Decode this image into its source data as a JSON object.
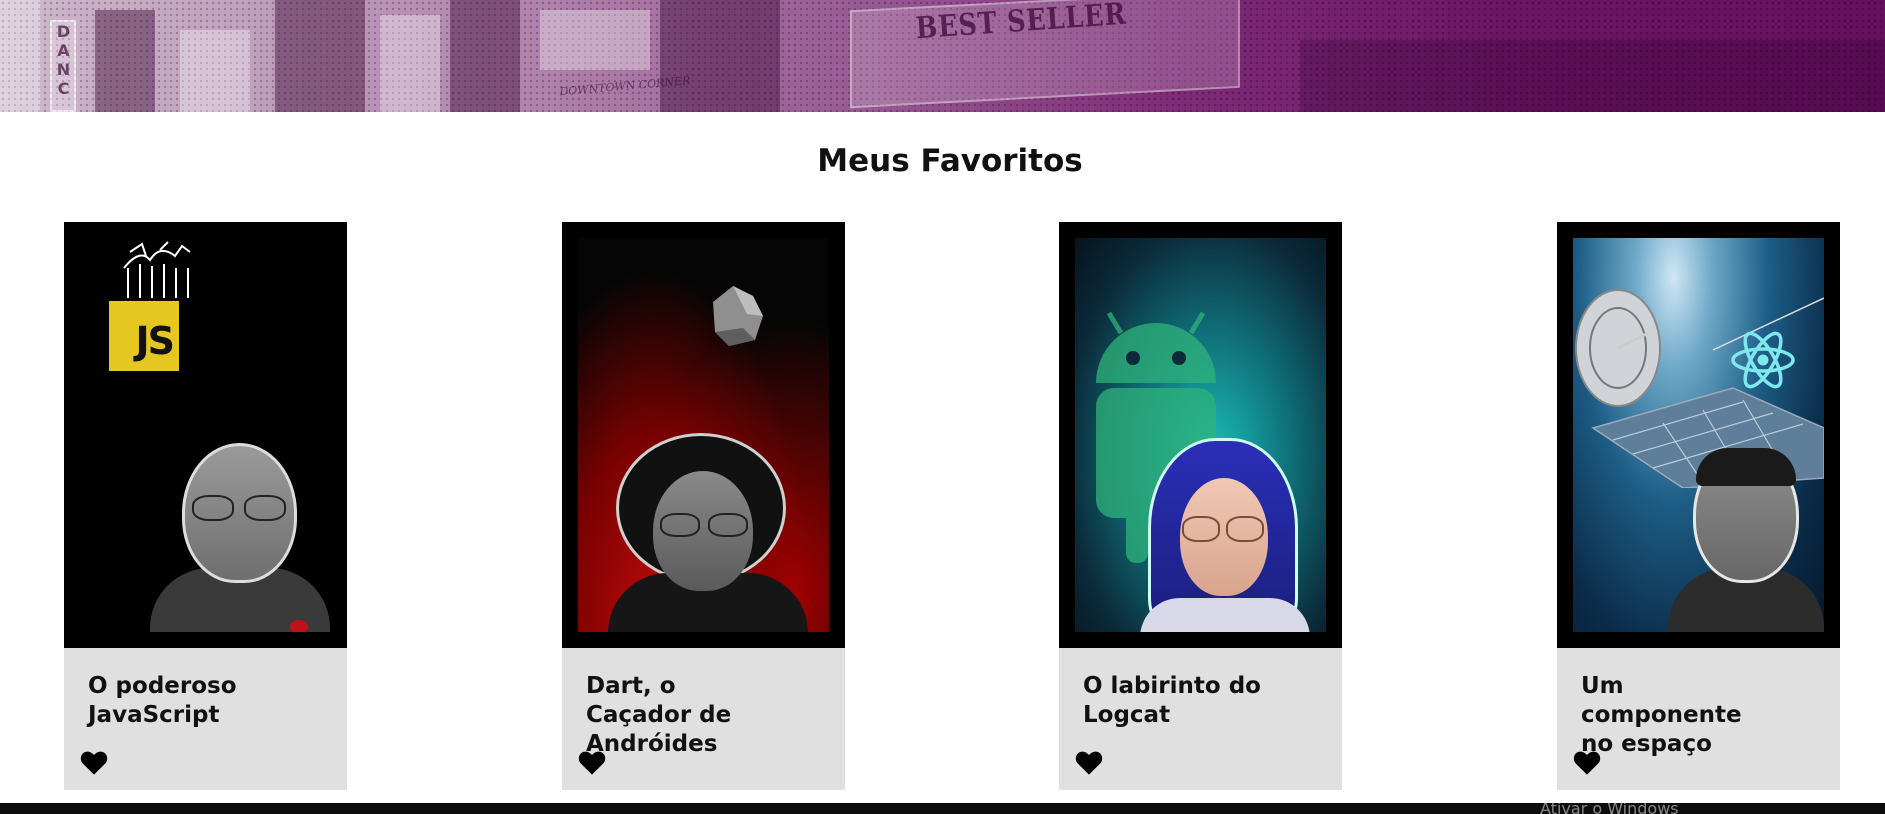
{
  "banner": {
    "sign_text": "BEST SELLER",
    "vertical_sign": "DANC",
    "small_sign": "DOWNTOWN CORNER"
  },
  "section": {
    "title": "Meus Favoritos"
  },
  "cards": [
    {
      "title": "O poderoso JavaScript",
      "poster_badge": "JS",
      "favorited": true
    },
    {
      "title": "Dart, o Caçador de Andróides",
      "favorited": true
    },
    {
      "title": "O labirinto do Logcat",
      "favorited": true
    },
    {
      "title": "Um componente no espaço",
      "favorited": true
    }
  ],
  "icons": {
    "favorite": "heart-icon"
  },
  "colors": {
    "banner_purple": "#6c1565",
    "card_background": "#e0e0e0",
    "poster_frame": "#000000",
    "js_yellow": "#e6c620",
    "heart": "#000000"
  },
  "system_watermark": "Ativar o Windows"
}
